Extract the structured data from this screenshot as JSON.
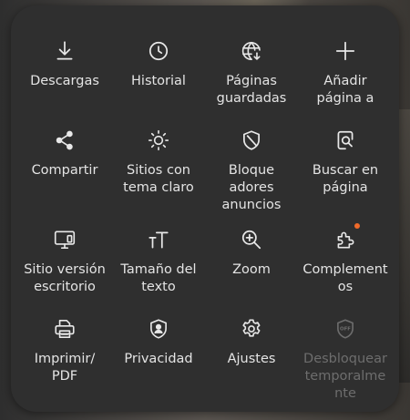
{
  "menu": {
    "items": [
      {
        "id": "downloads",
        "label": "Descargas",
        "icon": "download-icon"
      },
      {
        "id": "history",
        "label": "Historial",
        "icon": "clock-icon"
      },
      {
        "id": "saved-pages",
        "label": "Páginas\nguardadas",
        "icon": "globe-download-icon"
      },
      {
        "id": "add-page",
        "label": "Añadir\npágina a",
        "icon": "plus-icon"
      },
      {
        "id": "share",
        "label": "Compartir",
        "icon": "share-icon"
      },
      {
        "id": "light-theme",
        "label": "Sitios con\ntema claro",
        "icon": "sun-icon"
      },
      {
        "id": "ad-blockers",
        "label": "Bloque\nadores\nanuncios",
        "icon": "shield-icon"
      },
      {
        "id": "find-in-page",
        "label": "Buscar en\npágina",
        "icon": "find-in-page-icon"
      },
      {
        "id": "desktop-site",
        "label": "Sitio versión\nescritorio",
        "icon": "desktop-icon"
      },
      {
        "id": "text-size",
        "label": "Tamaño del\ntexto",
        "icon": "text-size-icon"
      },
      {
        "id": "zoom",
        "label": "Zoom",
        "icon": "zoom-in-icon"
      },
      {
        "id": "add-ons",
        "label": "Complement\nos",
        "icon": "puzzle-icon",
        "badge": true
      },
      {
        "id": "print",
        "label": "Imprimir/\nPDF",
        "icon": "printer-icon"
      },
      {
        "id": "privacy",
        "label": "Privacidad",
        "icon": "privacy-shield-icon"
      },
      {
        "id": "settings",
        "label": "Ajustes",
        "icon": "gear-icon"
      },
      {
        "id": "unlock-temp",
        "label": "Desbloquear\ntemporalme\nnte",
        "icon": "off-shield-icon",
        "disabled": true
      }
    ]
  },
  "colors": {
    "panel": "#2f2f2f",
    "text": "#e4e4e4",
    "icon": "#e8e8e8",
    "disabled": "#6d6d6d",
    "badge": "#f06a2a"
  }
}
